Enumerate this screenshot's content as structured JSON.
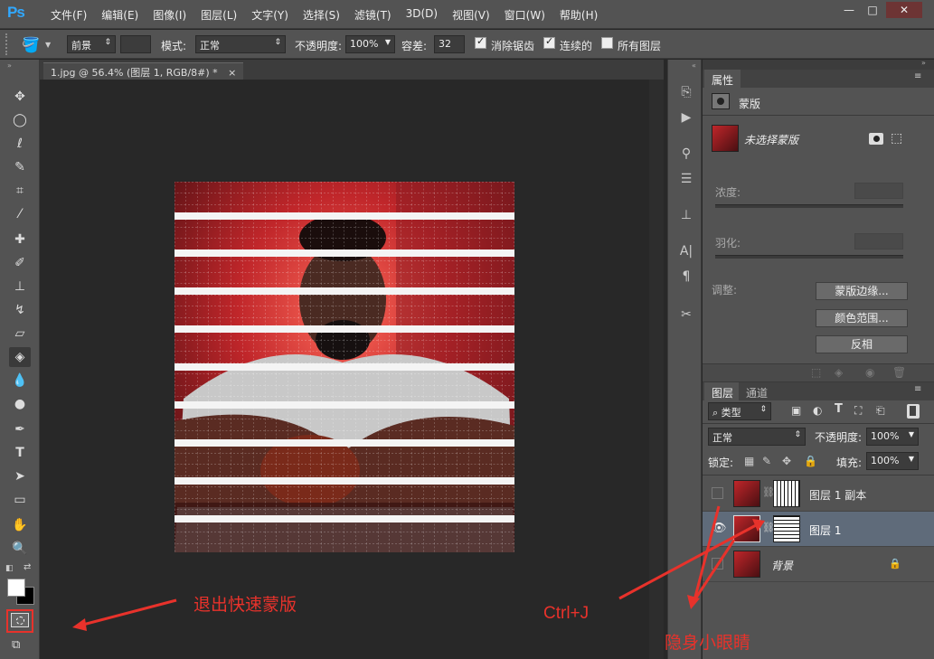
{
  "app": {
    "logo": "Ps"
  },
  "menu": [
    "文件(F)",
    "编辑(E)",
    "图像(I)",
    "图层(L)",
    "文字(Y)",
    "选择(S)",
    "滤镜(T)",
    "3D(D)",
    "视图(V)",
    "窗口(W)",
    "帮助(H)"
  ],
  "window_controls": {
    "minimize": "—",
    "maximize": "□",
    "close": "✕"
  },
  "options": {
    "fill_source": "前景",
    "mode_label": "模式:",
    "mode_value": "正常",
    "opacity_label": "不透明度:",
    "opacity_value": "100%",
    "tolerance_label": "容差:",
    "tolerance_value": "32",
    "antialias_label": "消除锯齿",
    "contiguous_label": "连续的",
    "all_layers_label": "所有图层"
  },
  "document_tab": {
    "title": "1.jpg @ 56.4% (图层 1, RGB/8#) *",
    "close": "×"
  },
  "properties": {
    "tab": "属性",
    "section": "蒙版",
    "mask_status": "未选择蒙版",
    "density_label": "浓度:",
    "feather_label": "羽化:",
    "adjust_label": "调整:",
    "btn_mask_edge": "蒙版边缘...",
    "btn_color_range": "颜色范围...",
    "btn_invert": "反相"
  },
  "layers_panel": {
    "tabs": [
      "图层",
      "通道"
    ],
    "filter_kind": "类型",
    "blend_mode": "正常",
    "opacity_label": "不透明度:",
    "opacity_value": "100%",
    "lock_label": "锁定:",
    "fill_label": "填充:",
    "fill_value": "100%",
    "layers": [
      {
        "name": "图层 1 副本",
        "visible": false,
        "has_mask": true,
        "selected": false
      },
      {
        "name": "图层 1",
        "visible": true,
        "has_mask": true,
        "selected": true
      },
      {
        "name": "背景",
        "visible": false,
        "has_mask": false,
        "locked": true,
        "selected": false
      }
    ]
  },
  "annotations": {
    "quick_mask": "退出快速蒙版",
    "ctrl_j": "Ctrl+J",
    "hide_eye": "隐身小眼睛"
  },
  "colors": {
    "annotation": "#e8322b",
    "selected_layer": "#5f6b7a",
    "logo": "#31a8ff"
  }
}
